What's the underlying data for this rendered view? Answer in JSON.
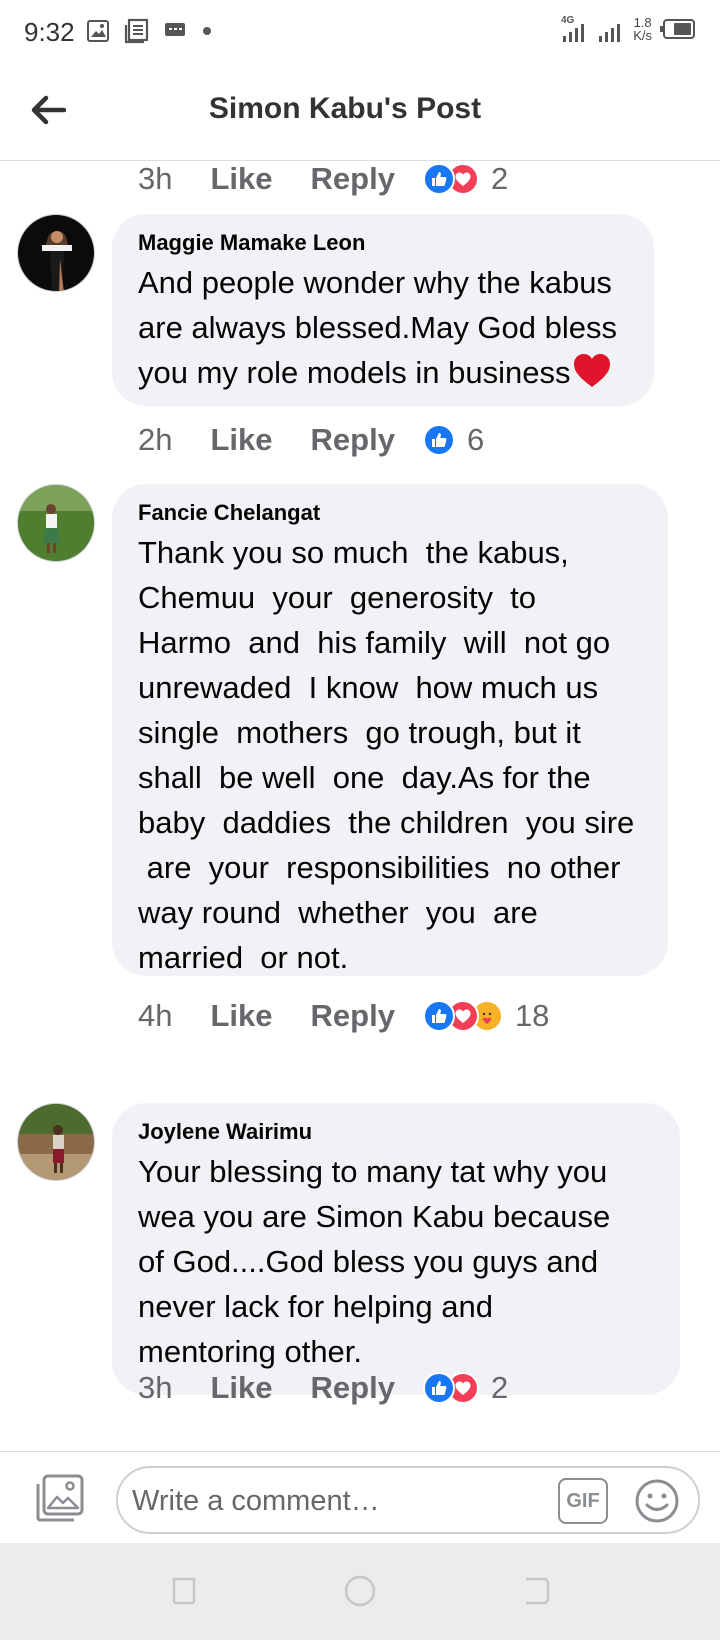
{
  "status_bar": {
    "time": "9:32",
    "network": "4G",
    "speed_value": "1.8",
    "speed_unit": "K/s"
  },
  "header": {
    "title": "Simon Kabu's Post"
  },
  "actions": {
    "like_label": "Like",
    "reply_label": "Reply"
  },
  "prev_comment_footer": {
    "time": "3h",
    "reactions": [
      "like",
      "love"
    ],
    "count": "2"
  },
  "comments": [
    {
      "name": "Maggie Mamake Leon",
      "text": "And people wonder why the kabus\nare always blessed.May God bless\nyou my role models in business",
      "emoji": "heart",
      "time": "2h",
      "reactions": [
        "like"
      ],
      "count": "6"
    },
    {
      "name": "Fancie Chelangat",
      "text": "Thank you so much  the kabus,\nChemuu  your  generosity  to\nHarmo  and  his family  will  not go\nunrewaded  I know  how much us\nsingle  mothers  go trough, but it\nshall  be well  one  day.As for the\nbaby  daddies  the children  you sire\n are  your  responsibilities  no other\nway round  whether  you  are\nmarried  or not.",
      "time": "4h",
      "reactions": [
        "like",
        "love",
        "care"
      ],
      "count": "18"
    },
    {
      "name": "Joylene Wairimu",
      "text": "Your blessing to many tat why you\nwea you are Simon Kabu because\nof God....God bless you guys and\nnever lack for helping and\nmentoring other.",
      "time": "3h",
      "reactions": [
        "like",
        "love"
      ],
      "count": "2"
    }
  ],
  "composer": {
    "placeholder": "Write a comment…",
    "gif_label": "GIF"
  },
  "colors": {
    "bubble": "#f0f2f5",
    "like_blue": "#1877f2",
    "love_red": "#f33e58",
    "care_yellow": "#f7b125",
    "meta_gray": "#65676b"
  }
}
